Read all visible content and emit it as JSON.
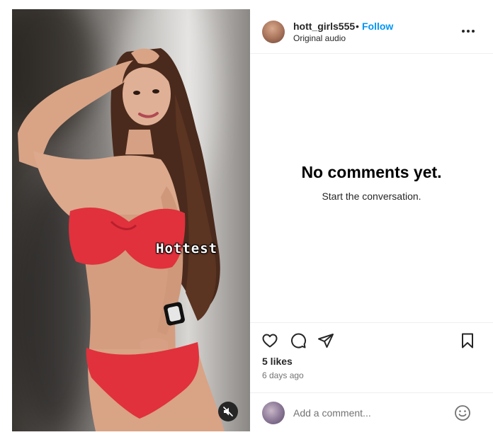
{
  "media": {
    "overlay_text": "Hottest"
  },
  "header": {
    "username": "hott_girls555",
    "separator": "•",
    "follow_label": "Follow",
    "audio_label": "Original audio"
  },
  "comments": {
    "empty_title": "No comments yet.",
    "empty_subtitle": "Start the conversation."
  },
  "engagement": {
    "likes": "5 likes",
    "posted": "6 days ago"
  },
  "composer": {
    "placeholder": "Add a comment..."
  },
  "icons": {
    "like": "heart-icon",
    "comment": "speech-bubble-icon",
    "share": "paper-plane-icon",
    "save": "bookmark-icon",
    "more": "more-options-icon",
    "mute": "speaker-muted-icon",
    "emoji": "smiley-icon"
  },
  "colors": {
    "follow": "#0095f6",
    "swimsuit": "#e0313d",
    "mute_button": "#262626"
  }
}
